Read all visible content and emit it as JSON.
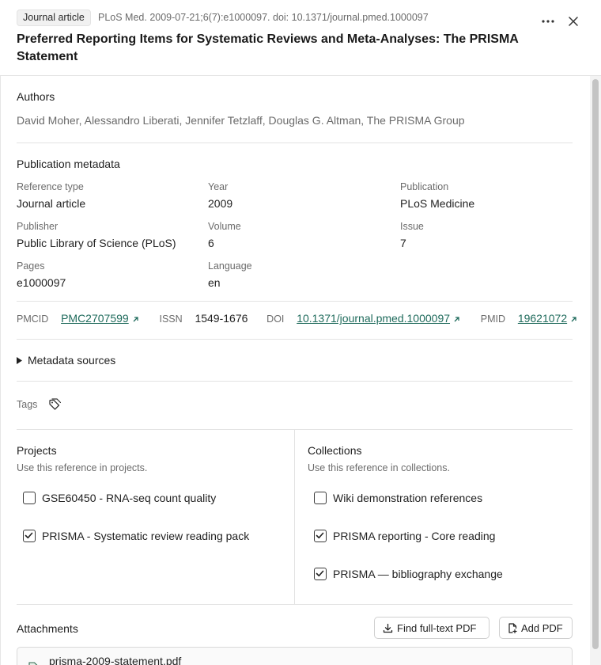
{
  "header": {
    "badge": "Journal article",
    "citation": "PLoS Med. 2009-07-21;6(7):e1000097. doi: 10.1371/journal.pmed.1000097",
    "title": "Preferred Reporting Items for Systematic Reviews and Meta-Analyses: The PRISMA Statement"
  },
  "authors": {
    "heading": "Authors",
    "value": "David Moher, Alessandro Liberati, Jennifer Tetzlaff, Douglas G. Altman, The PRISMA Group"
  },
  "metadata": {
    "heading": "Publication metadata",
    "fields": [
      {
        "label": "Reference type",
        "value": "Journal article"
      },
      {
        "label": "Year",
        "value": "2009"
      },
      {
        "label": "Publication",
        "value": "PLoS Medicine"
      },
      {
        "label": "Publisher",
        "value": "Public Library of Science (PLoS)"
      },
      {
        "label": "Volume",
        "value": "6"
      },
      {
        "label": "Issue",
        "value": "7"
      },
      {
        "label": "Pages",
        "value": "e1000097"
      },
      {
        "label": "Language",
        "value": "en"
      }
    ]
  },
  "identifiers": {
    "pmcid_label": "PMCID",
    "pmcid": "PMC2707599",
    "issn_label": "ISSN",
    "issn": "1549-1676",
    "doi_label": "DOI",
    "doi": "10.1371/journal.pmed.1000097",
    "pmid_label": "PMID",
    "pmid": "19621072"
  },
  "metadata_sources": "Metadata sources",
  "tags": {
    "label": "Tags"
  },
  "projects": {
    "heading": "Projects",
    "subtitle": "Use this reference in projects.",
    "items": [
      {
        "label": "GSE60450 - RNA-seq count quality",
        "checked": false
      },
      {
        "label": "PRISMA - Systematic review reading pack",
        "checked": true
      }
    ]
  },
  "collections": {
    "heading": "Collections",
    "subtitle": "Use this reference in collections.",
    "items": [
      {
        "label": "Wiki demonstration references",
        "checked": false
      },
      {
        "label": "PRISMA reporting - Core reading",
        "checked": true
      },
      {
        "label": "PRISMA — bibliography exchange",
        "checked": true
      }
    ]
  },
  "attachments": {
    "heading": "Attachments",
    "find_pdf": "Find full-text PDF",
    "add_pdf": "Add PDF",
    "file": "prisma-2009-statement.pdf"
  },
  "colors": {
    "link": "#1f6b5c",
    "text": "#1f1f1f",
    "muted": "#6b6b6b",
    "divider": "#e3e3e3"
  }
}
